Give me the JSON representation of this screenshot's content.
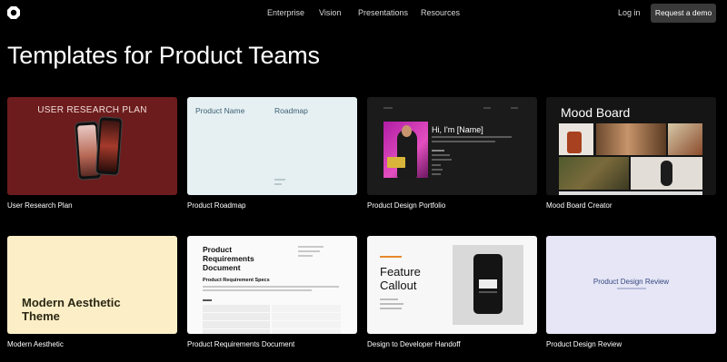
{
  "nav": {
    "items": [
      "Enterprise",
      "Vision",
      "Presentations",
      "Resources"
    ],
    "login_label": "Log in",
    "demo_label": "Request a demo"
  },
  "page_title": "Templates for Product Teams",
  "cards": [
    {
      "caption": "User Research Plan",
      "thumb_title": "USER RESEARCH PLAN"
    },
    {
      "caption": "Product Roadmap",
      "thumb_title": "Product Name",
      "thumb_title2": "Roadmap"
    },
    {
      "caption": "Product Design Portfolio",
      "thumb_title": "Hi, I'm [Name]"
    },
    {
      "caption": "Mood Board Creator",
      "thumb_title": "Mood Board"
    },
    {
      "caption": "Modern Aesthetic",
      "thumb_title": "Modern Aesthetic Theme"
    },
    {
      "caption": "Product Requirements Document",
      "thumb_title": "Product Requirements Document",
      "thumb_subtitle": "Product Requirement Specs"
    },
    {
      "caption": "Design to Developer Handoff",
      "thumb_title": "Feature Callout"
    },
    {
      "caption": "Product Design Review",
      "thumb_title": "Product Design Review"
    }
  ],
  "colors": {
    "background": "#000000",
    "demo_button": "#3a3a3a",
    "research_bg": "#6d1c1d",
    "roadmap_bg": "#e6f0f2",
    "aesthetic_bg": "#fcefc7",
    "review_bg": "#e6e6f6"
  },
  "icons": {
    "logo": "pitch-logo-icon"
  }
}
